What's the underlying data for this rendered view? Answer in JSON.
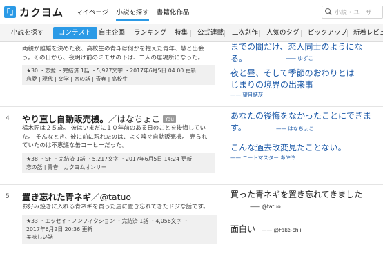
{
  "header": {
    "logo_mark": "「」",
    "logo_text": "カクヨム",
    "nav": [
      "マイページ",
      "小説を探す",
      "書籍化作品"
    ],
    "search_placeholder": "小説・ユーザ"
  },
  "tabs": [
    {
      "label": "小説を探す"
    },
    {
      "label": "コンテスト"
    },
    {
      "label": "自主企画"
    },
    {
      "label": "ランキング"
    },
    {
      "label": "特集"
    },
    {
      "label": "公式連載"
    },
    {
      "label": "二次創作"
    },
    {
      "label": "人気のタグ"
    },
    {
      "label": "ピックアップ"
    },
    {
      "label": "新着レビュー"
    }
  ],
  "items": [
    {
      "rank": "",
      "desc": [
        "両親が離婚を決めた夜、高校生の青斗は何かを抱えた青年、慧と出会",
        "う。その日から、夜明け前のミモザの下は、二人の居場所になった。"
      ],
      "meta": [
        "★30 ・恋愛 ・完結済 1話 ・5,977文字 ・2017年6月5日 04:00 更新",
        "恋愛 | 現代 | 文学 | 恋の話 | 青春 | 高校生"
      ],
      "reviews": [
        {
          "body": "までの間だけ、恋人同士のようになる。",
          "author": "—— ゆずこ"
        },
        {
          "body": "夜と昼、そして季節のおわりとはじまりの境界の出来事",
          "author": "—— 望月結灰"
        }
      ]
    },
    {
      "rank": "4",
      "title": "やり直し自動販売機。",
      "author": "／はなちょこ",
      "badge": "You",
      "desc": [
        "橘木匠は２５歳。 彼はいまだに１０年前のある日のことを後悔してい",
        "た。 そんなとき、彼に前に現れたのは、よく嗅ぐ自動販売機。 売られ",
        "ていたのは不恵議な缶コーヒーだった。"
      ],
      "meta": [
        "★38 ・SF ・完結済 1話 ・5,217文字 ・2017年6月5日 14:24 更新",
        "恋の話 | 青春 | カクヨムオンリー"
      ],
      "reviews": [
        {
          "body": "あなたの後悔をなかったことにできます。",
          "author": "—— はなちょこ"
        },
        {
          "body": "こんな過去改変見たことない。",
          "author": "—— ニートマスター あやや"
        }
      ]
    },
    {
      "rank": "5",
      "title": "置き忘れた青ネギ",
      "author": "／@tatuo",
      "desc": [
        "お好み焼きに入れる青ネギを買った店に置き忘れてきたドジな話です。"
      ],
      "meta": [
        "★33 ・エッセイ・ノンフィクション ・完結済 1話 ・4,056文字 ・",
        "2017年6月2日 20:36 更新",
        "美味しい話"
      ],
      "reviews": [
        {
          "body": "買った青ネギを置き忘れてきました",
          "author": "—— @tatuo"
        },
        {
          "body": "面白い",
          "author": "—— @Fake-chii"
        }
      ]
    }
  ]
}
